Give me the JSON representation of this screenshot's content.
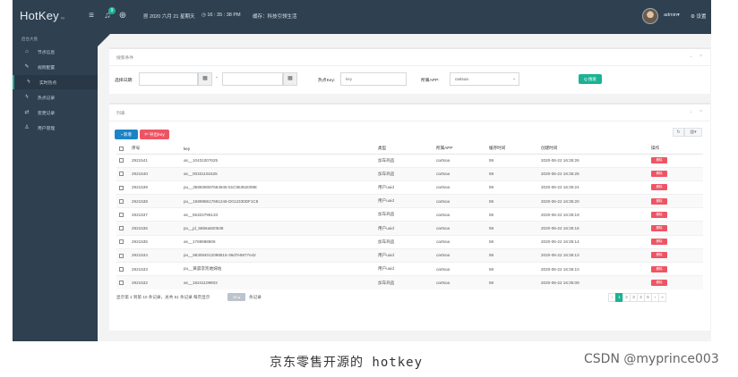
{
  "topbar": {
    "logo": "HotKey",
    "logo_suffix": "∞",
    "badge": "9",
    "datetime": "2020 六月 21 星期天",
    "time": "16 : 35 : 38 PM",
    "notice": "缓存：科技引领生活",
    "user": "admin",
    "settings": "设置"
  },
  "sidebar": {
    "head": "后台大盘",
    "items": [
      {
        "label": "节点信息",
        "icon": "home-icon"
      },
      {
        "label": "规则配置",
        "icon": "wrench-icon"
      },
      {
        "label": "实时热点",
        "icon": "bolt-icon"
      },
      {
        "label": "热点记录",
        "icon": "bolt-icon"
      },
      {
        "label": "变更记录",
        "icon": "exchange-icon"
      },
      {
        "label": "用户管理",
        "icon": "user-icon"
      }
    ]
  },
  "search_panel": {
    "title": "搜索条件",
    "tools": "⌄ ×",
    "date_label": "选择日期:",
    "dash": "-",
    "key_label": "热点Key:",
    "key_placeholder": "key",
    "app_label": "所属APP:",
    "app_value": "cartsoa",
    "search_btn": "Q 搜索"
  },
  "list_panel": {
    "title": "列表",
    "tools": "⌄ ×",
    "add_btn": "新增",
    "export_btn": "导出Key",
    "columns": [
      "序号",
      "key",
      "类型",
      "所属APP",
      "缓存时间",
      "创建时间",
      "操作"
    ],
    "rows": [
      [
        "2921541",
        "as__10431007625",
        "加车商品",
        "cartsoa",
        "59",
        "2020-06-22 16:35:26"
      ],
      [
        "2921540",
        "as__00331191625",
        "加车商品",
        "cartsoa",
        "59",
        "2020-06-22 16:35:25"
      ],
      [
        "2921539",
        "pu__358508087664645-51C95352009E",
        "用户uuid",
        "cartsoa",
        "59",
        "2020-06-22 16:35:24"
      ],
      [
        "2921538",
        "pu__158998617691246-D012330DF1C8",
        "用户uuid",
        "cartsoa",
        "59",
        "2020-06-22 16:35:20"
      ],
      [
        "2921537",
        "as__55323796133",
        "加车商品",
        "cartsoa",
        "59",
        "2020-06-22 16:35:19"
      ],
      [
        "2921536",
        "pu__jd_5856a920538",
        "用户uuid",
        "cartsoa",
        "59",
        "2020-06-22 16:35:16"
      ],
      [
        "2921535",
        "as__1769988806",
        "加车商品",
        "cartsoa",
        "59",
        "2020-06-22 16:35:14"
      ],
      [
        "2921534",
        "pu__863064012098515-36d7e5877e42",
        "用户uuid",
        "cartsoa",
        "59",
        "2020-06-22 16:35:13"
      ],
      [
        "2921533",
        "pu__黄晨李凯她婦佑",
        "用户uuid",
        "cartsoa",
        "59",
        "2020-06-22 16:35:10"
      ],
      [
        "2921532",
        "as__18241109903",
        "加车商品",
        "cartsoa",
        "59",
        "2020-06-22 16:35:09"
      ]
    ],
    "delete_label": "删除",
    "footer_text": "显示第 1 到第 10 条记录，总共 61 条记录 每页显示",
    "page_size": "10 ▴",
    "footer_suffix": "条记录",
    "pages": [
      "‹",
      "1",
      "2",
      "3",
      "4",
      "5",
      "›",
      "»"
    ]
  },
  "caption": "京东零售开源的 hotkey",
  "watermark": "CSDN @myprince003"
}
